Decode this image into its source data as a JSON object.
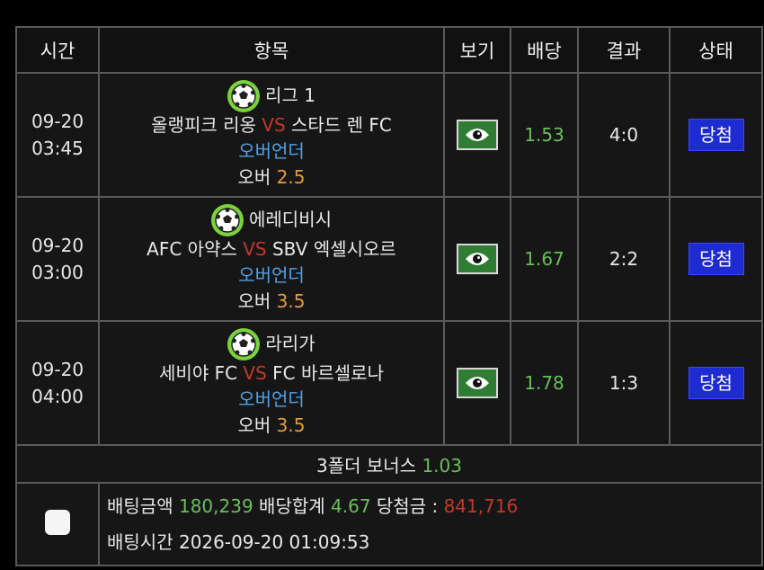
{
  "headers": {
    "time": "시간",
    "item": "항목",
    "view": "보기",
    "odds": "배당",
    "result": "결과",
    "status": "상태"
  },
  "matches": [
    {
      "date": "09-20",
      "time": "03:45",
      "league": "리그 1",
      "home": "올랭피크 리옹",
      "vs": "VS",
      "away": "스타드 렌 FC",
      "market": "오버언더",
      "pick": "오버",
      "line": "2.5",
      "odds": "1.53",
      "score": "4:0",
      "status": "당첨"
    },
    {
      "date": "09-20",
      "time": "03:00",
      "league": "에레디비시",
      "home": "AFC 아약스",
      "vs": "VS",
      "away": "SBV 엑셀시오르",
      "market": "오버언더",
      "pick": "오버",
      "line": "3.5",
      "odds": "1.67",
      "score": "2:2",
      "status": "당첨"
    },
    {
      "date": "09-20",
      "time": "04:00",
      "league": "라리가",
      "home": "세비야 FC",
      "vs": "VS",
      "away": "FC 바르셀로나",
      "market": "오버언더",
      "pick": "오버",
      "line": "3.5",
      "odds": "1.78",
      "score": "1:3",
      "status": "당첨"
    }
  ],
  "bonus": {
    "label": "3폴더 보너스",
    "value": "1.03"
  },
  "summary": {
    "bet_amount_label": "배팅금액",
    "bet_amount": "180,239",
    "total_odds_label": "배당합계",
    "total_odds": "4.67",
    "payout_label": "당첨금 :",
    "payout": "841,716",
    "bet_time_label": "배팅시간",
    "bet_time": "2026-09-20 01:09:53"
  },
  "icons": {
    "league": "soccer-ball-icon",
    "view": "eye-icon"
  },
  "colors": {
    "odds": "#6abf5a",
    "vs": "#c0392b",
    "market": "#4fa3e8",
    "line": "#e69a3a",
    "win_badge": "#1e2bd0",
    "view_button": "#2e7d32"
  }
}
